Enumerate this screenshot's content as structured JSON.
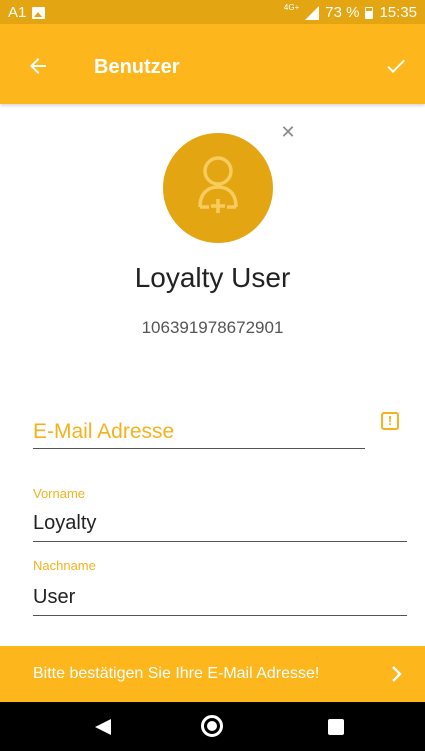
{
  "status_bar": {
    "carrier": "A1",
    "network": "4G+",
    "battery": "73 %",
    "time": "15:35"
  },
  "app_bar": {
    "title": "Benutzer",
    "back_icon": "arrow-back-icon",
    "confirm_icon": "check-icon"
  },
  "profile": {
    "avatar_icon": "add-user-icon",
    "remove_icon": "close-icon",
    "name": "Loyalty User",
    "id": "106391978672901"
  },
  "form": {
    "email": {
      "placeholder": "E-Mail Adresse",
      "value": "",
      "warning_icon": "warning-icon"
    },
    "first_name": {
      "label": "Vorname",
      "value": "Loyalty"
    },
    "last_name": {
      "label": "Nachname",
      "value": "User"
    }
  },
  "banner": {
    "text": "Bitte bestätigen Sie Ihre E-Mail Adresse!",
    "icon": "chevron-right-icon"
  },
  "colors": {
    "accent": "#FDB61C",
    "accent_dark": "#E3A512",
    "text": "#222222"
  }
}
